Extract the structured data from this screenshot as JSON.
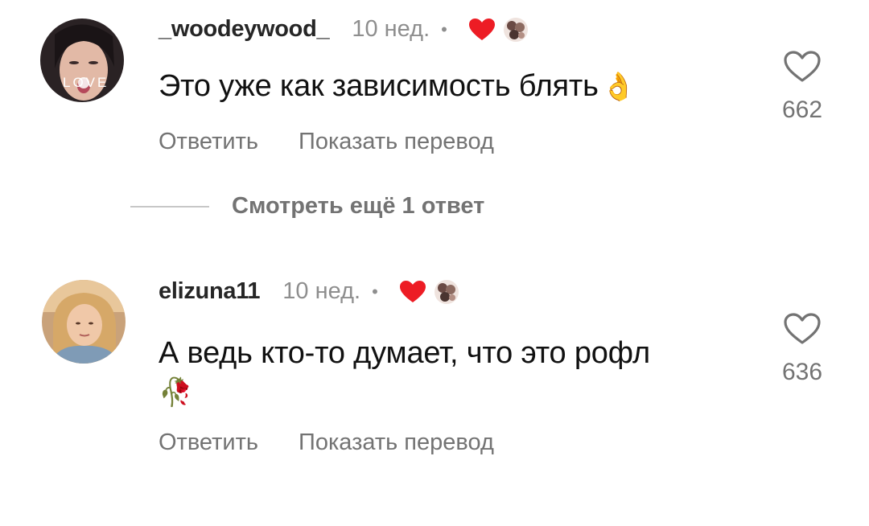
{
  "comments": [
    {
      "username": "_woodeywood_",
      "time": "10 нед.",
      "separator": "•",
      "avatar_overlay_text": "LOVE",
      "text": "Это уже как зависимость блять",
      "emoji": "👌",
      "reply_label": "Ответить",
      "translate_label": "Показать перевод",
      "like_count": "662"
    },
    {
      "username": "elizuna11",
      "time": "10 нед.",
      "separator": "•",
      "text": "А ведь кто-то думает, что это рофл",
      "emoji": "🥀",
      "reply_label": "Ответить",
      "translate_label": "Показать перевод",
      "like_count": "636"
    }
  ],
  "view_replies_label": "Смотреть ещё 1 ответ",
  "colors": {
    "heart_red": "#ed1c24",
    "muted_text": "#737373",
    "username": "#262626"
  }
}
